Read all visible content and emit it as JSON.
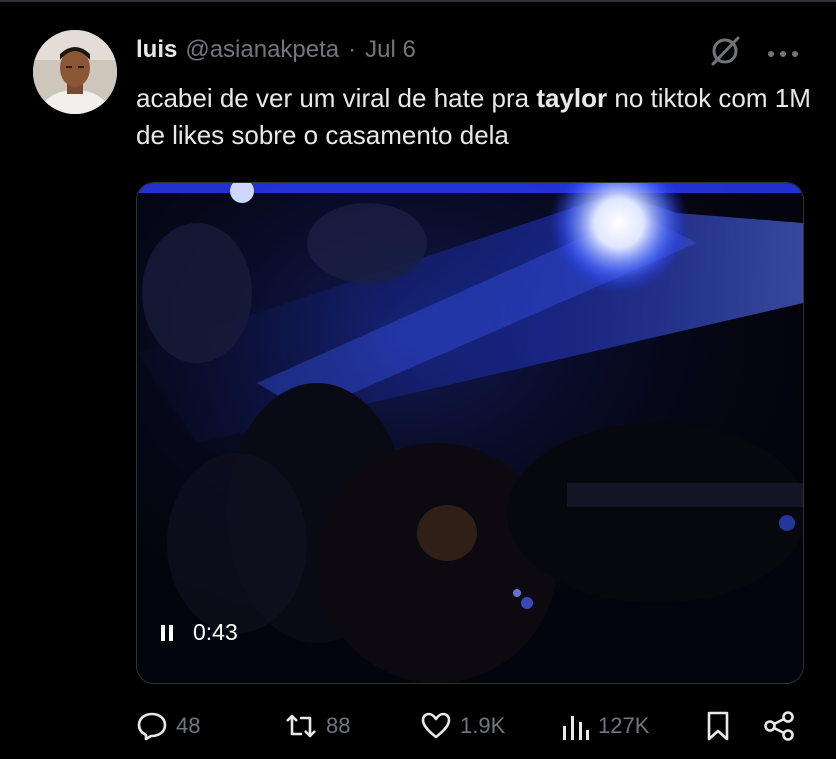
{
  "tweet": {
    "author": {
      "display_name": "luis",
      "handle": "@asianakpeta",
      "separator": "·",
      "date": "Jul 6"
    },
    "text": {
      "part1": "acabei de ver um viral de hate pra ",
      "bold": "taylor",
      "part2": " no tiktok com 1M de likes sobre o casamento dela"
    },
    "header_icons": [
      "grok-icon",
      "more-icon"
    ],
    "video": {
      "time": "0:43",
      "state_icon": "pause-icon"
    },
    "stats": {
      "replies": "48",
      "reposts": "88",
      "likes": "1.9K",
      "views": "127K"
    }
  },
  "colors": {
    "background": "#000000",
    "text_primary": "#e7e9ea",
    "text_secondary": "#71767b",
    "border": "#2f3336",
    "video_light": "#3a5cff"
  }
}
